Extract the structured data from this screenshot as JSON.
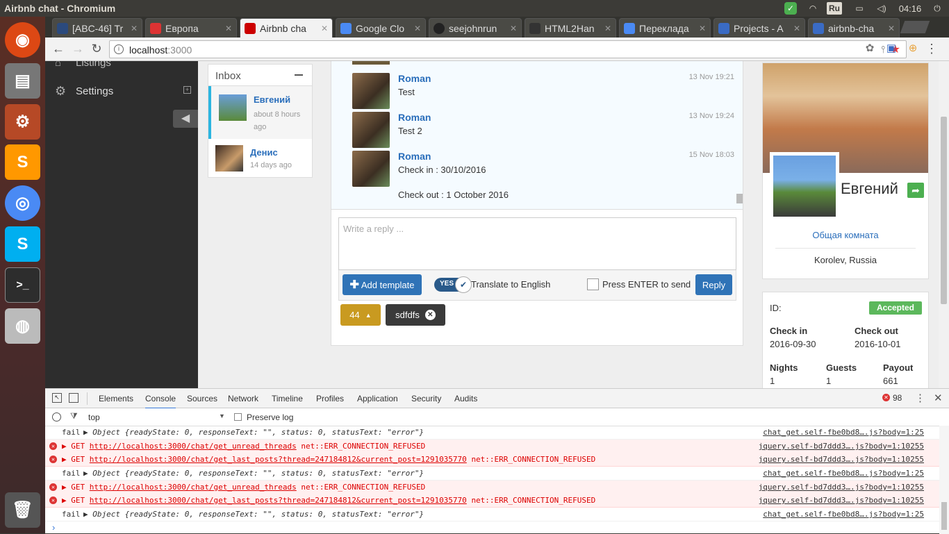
{
  "window": {
    "title": "Airbnb chat - Chromium"
  },
  "tray": {
    "lang": "Ru",
    "time": "04:16"
  },
  "tabs": [
    {
      "label": "[ABC-46] Tr",
      "fav_color": "#2b4a7d"
    },
    {
      "label": "Европа",
      "fav_color": "#d33"
    },
    {
      "label": "Airbnb cha",
      "fav_color": "#c00"
    },
    {
      "label": "Google Clo",
      "fav_color": "#4a8af4"
    },
    {
      "label": "seejohnrun",
      "fav_color": "#222"
    },
    {
      "label": "HTML2Han",
      "fav_color": "#333"
    },
    {
      "label": "Переклада",
      "fav_color": "#4a8af4"
    },
    {
      "label": "Projects - A",
      "fav_color": "#3a6bc4"
    },
    {
      "label": "airbnb-cha",
      "fav_color": "#3a6bc4"
    }
  ],
  "address": {
    "host": "localhost",
    "port": ":3000"
  },
  "sidebar": {
    "listings": "Listings",
    "settings": "Settings"
  },
  "inbox": {
    "title": "Inbox",
    "threads": [
      {
        "name": "Евгений",
        "time": "about 8 hours ago"
      },
      {
        "name": "Денис",
        "time": "14 days ago"
      }
    ]
  },
  "messages": [
    {
      "author": "Roman",
      "date": "13 Nov 19:21",
      "text": "Test"
    },
    {
      "author": "Roman",
      "date": "13 Nov 19:24",
      "text": "Test 2"
    },
    {
      "author": "Roman",
      "date": "15 Nov 18:03",
      "text": "Check in : 30/10/2016",
      "text2": "Check out : 1 October 2016"
    }
  ],
  "reply": {
    "placeholder": "Write a reply ...",
    "add_template": "Add template",
    "yes": "YES",
    "translate": "Translate to English",
    "enter_send": "Press ENTER to send",
    "reply_btn": "Reply",
    "count_badge": "44",
    "tag": "sdfdfs"
  },
  "profile": {
    "name": "Евгений",
    "room_type": "Общая комната",
    "location": "Korolev, Russia"
  },
  "booking": {
    "id_label": "ID:",
    "status": "Accepted",
    "checkin_label": "Check in",
    "checkin": "2016-09-30",
    "checkout_label": "Check out",
    "checkout": "2016-10-01",
    "nights_label": "Nights",
    "nights": "1",
    "guests_label": "Guests",
    "guests": "1",
    "payout_label": "Payout",
    "payout": "661"
  },
  "devtools": {
    "tabs": [
      "Elements",
      "Console",
      "Sources",
      "Network",
      "Timeline",
      "Profiles",
      "Application",
      "Security",
      "Audits"
    ],
    "error_count": "98",
    "context": "top",
    "preserve_log": "Preserve log",
    "logs": [
      {
        "type": "fail",
        "level": "fail",
        "msg": "Object {readyState: 0, responseText: \"\", status: 0, statusText: \"error\"}",
        "source": "chat_get.self-fbe0bd8….js?body=1:25"
      },
      {
        "type": "err",
        "method": "GET",
        "url": "http://localhost:3000/chat/get_unread_threads",
        "error": "net::ERR_CONNECTION_REFUSED",
        "source": "jquery.self-bd7ddd3….js?body=1:10255"
      },
      {
        "type": "err",
        "method": "GET",
        "url": "http://localhost:3000/chat/get_last_posts?thread=247184812&current_post=1291035770",
        "error": "net::ERR_CONNECTION_REFUSED",
        "source": "jquery.self-bd7ddd3….js?body=1:10255"
      },
      {
        "type": "fail",
        "level": "fail",
        "msg": "Object {readyState: 0, responseText: \"\", status: 0, statusText: \"error\"}",
        "source": "chat_get.self-fbe0bd8….js?body=1:25"
      },
      {
        "type": "err",
        "method": "GET",
        "url": "http://localhost:3000/chat/get_unread_threads",
        "error": "net::ERR_CONNECTION_REFUSED",
        "source": "jquery.self-bd7ddd3….js?body=1:10255"
      },
      {
        "type": "err",
        "method": "GET",
        "url": "http://localhost:3000/chat/get_last_posts?thread=247184812&current_post=1291035770",
        "error": "net::ERR_CONNECTION_REFUSED",
        "source": "jquery.self-bd7ddd3….js?body=1:10255"
      },
      {
        "type": "fail",
        "level": "fail",
        "msg": "Object {readyState: 0, responseText: \"\", status: 0, statusText: \"error\"}",
        "source": "chat_get.self-fbe0bd8….js?body=1:25"
      }
    ]
  }
}
